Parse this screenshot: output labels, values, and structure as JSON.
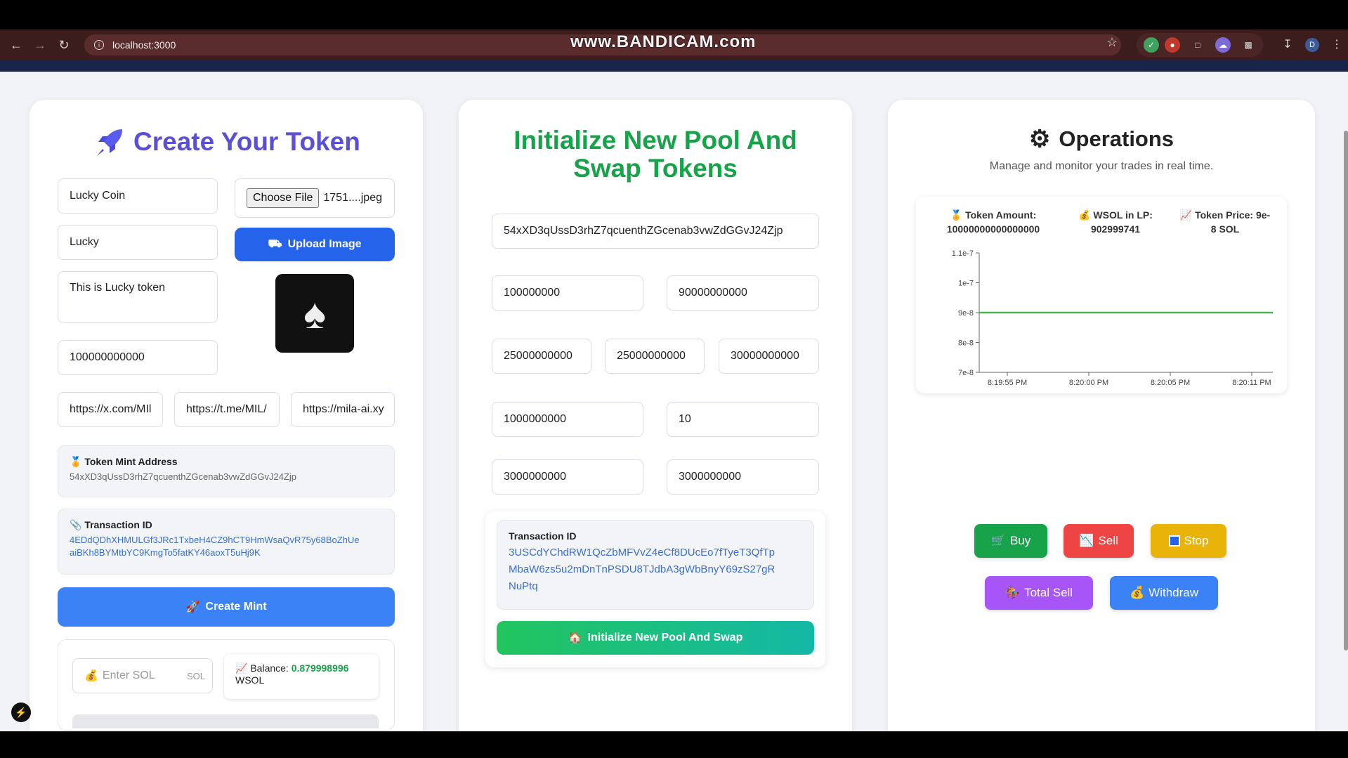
{
  "browser": {
    "url": "localhost:3000",
    "watermark": "www.BANDICAM.com",
    "profile_initial": "D"
  },
  "create_token": {
    "title": "Create Your Token",
    "name_value": "Lucky Coin",
    "symbol_value": "Lucky",
    "description_value": "This is Lucky token",
    "supply_value": "100000000000",
    "file_button_label": "Choose File",
    "file_name": "1751....jpeg",
    "upload_label": "Upload Image",
    "twitter_value": "https://x.com/MIl",
    "telegram_value": "https://t.me/MIL/",
    "website_value": "https://mila-ai.xy",
    "mint_address_label": "Token Mint Address",
    "mint_address_value": "54xXD3qUssD3rhZ7qcuenthZGcenab3vwZdGGvJ24Zjp",
    "tx_label": "Transaction ID",
    "tx_value_line1": "4EDdQDhXHMULGf3JRc1TxbeH4CZ9hCT9HmWsaQvR75y68BoZhUe",
    "tx_value_line2": "aiBKh8BYMtbYC9KmgTo5fatKY46aoxT5uHj9K",
    "create_mint_label": "Create Mint",
    "sol_placeholder": "Enter SOL",
    "sol_unit": "SOL",
    "balance_label": "Balance:",
    "balance_value": "0.879998996",
    "balance_unit": "WSOL"
  },
  "pool": {
    "title_line1": "Initialize New Pool And",
    "title_line2": "Swap Tokens",
    "mint_value": "54xXD3qUssD3rhZ7qcuenthZGcenab3vwZdGGvJ24Zjp",
    "field_a": "100000000",
    "field_b": "90000000000",
    "field_c": "25000000000",
    "field_d": "25000000000",
    "field_e": "30000000000",
    "field_f": "1000000000",
    "field_g": "10",
    "field_h": "3000000000",
    "field_i": "3000000000",
    "tx_label": "Transaction ID",
    "tx_line1": "3USCdYChdRW1QcZbMFVvZ4eCf8DUcEo7fTyeT3QfTp",
    "tx_line2": "MbaW6zs5u2mDnTnPSDU8TJdbA3gWbBnyY69zS27gR",
    "tx_line3": "NuPtq",
    "init_label": "Initialize New Pool And Swap"
  },
  "operations": {
    "title": "Operations",
    "subtitle": "Manage and monitor your trades in real time.",
    "token_amount_label": "Token Amount:",
    "token_amount_value": "10000000000000000",
    "wsol_label": "WSOL in LP:",
    "wsol_value": "902999741",
    "price_label": "Token Price: 9e-",
    "price_label_2": "8 SOL",
    "buy_label": "Buy",
    "sell_label": "Sell",
    "stop_label": "Stop",
    "total_sell_label": "Total Sell",
    "withdraw_label": "Withdraw"
  },
  "chart_data": {
    "type": "line",
    "x": [
      "8:19:55 PM",
      "8:20:00 PM",
      "8:20:05 PM",
      "8:20:11 PM"
    ],
    "series": [
      {
        "values": [
          9e-08,
          9e-08,
          9e-08,
          9e-08
        ]
      }
    ],
    "yticks": [
      "1.1e-7",
      "1e-7",
      "9e-8",
      "8e-8",
      "7e-8"
    ],
    "ylim": [
      7e-08,
      1.1e-07
    ],
    "color": "#4caf50"
  }
}
